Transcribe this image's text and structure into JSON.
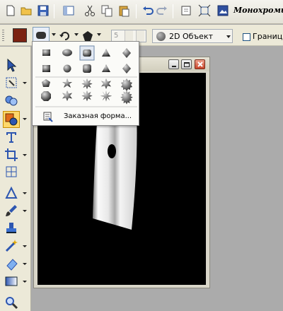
{
  "toolbar": {
    "document_title": "Монохроми",
    "icons": [
      "new-document-icon",
      "open-folder-icon",
      "save-icon",
      "toggle-panel-icon",
      "cut-icon",
      "copy-icon",
      "paste-icon",
      "undo-icon",
      "redo-icon",
      "crop-icon",
      "resize-icon",
      "image-properties-icon"
    ]
  },
  "options_bar": {
    "fill_color": "#7b2211",
    "size_value": "5",
    "object_mode": "2D Объект",
    "border_checked": false,
    "border_label": "Граница"
  },
  "shape_menu": {
    "rows": [
      [
        "square",
        "ellipse",
        "rounded-square",
        "triangle",
        "diamond"
      ],
      [
        "square",
        "circle",
        "rounded-square",
        "triangle",
        "diamond"
      ],
      [
        "pentagon",
        "star-5",
        "star-8",
        "star-6",
        "seal"
      ],
      [
        "octagon",
        "star-6",
        "star-8",
        "flower-8",
        "burst"
      ]
    ],
    "selected": "rounded-square",
    "custom_label": "Заказная форма..."
  },
  "tools": [
    "pointer-tool",
    "transform-tool",
    "link-tool",
    "shape-tool",
    "text-tool",
    "crop-tool",
    "grid-tool",
    "triangle-tool",
    "brush-tool",
    "stamp-tool",
    "magic-wand-tool",
    "eraser-tool",
    "gradient-tool",
    "zoom-tool"
  ],
  "active_tool": "shape-tool"
}
